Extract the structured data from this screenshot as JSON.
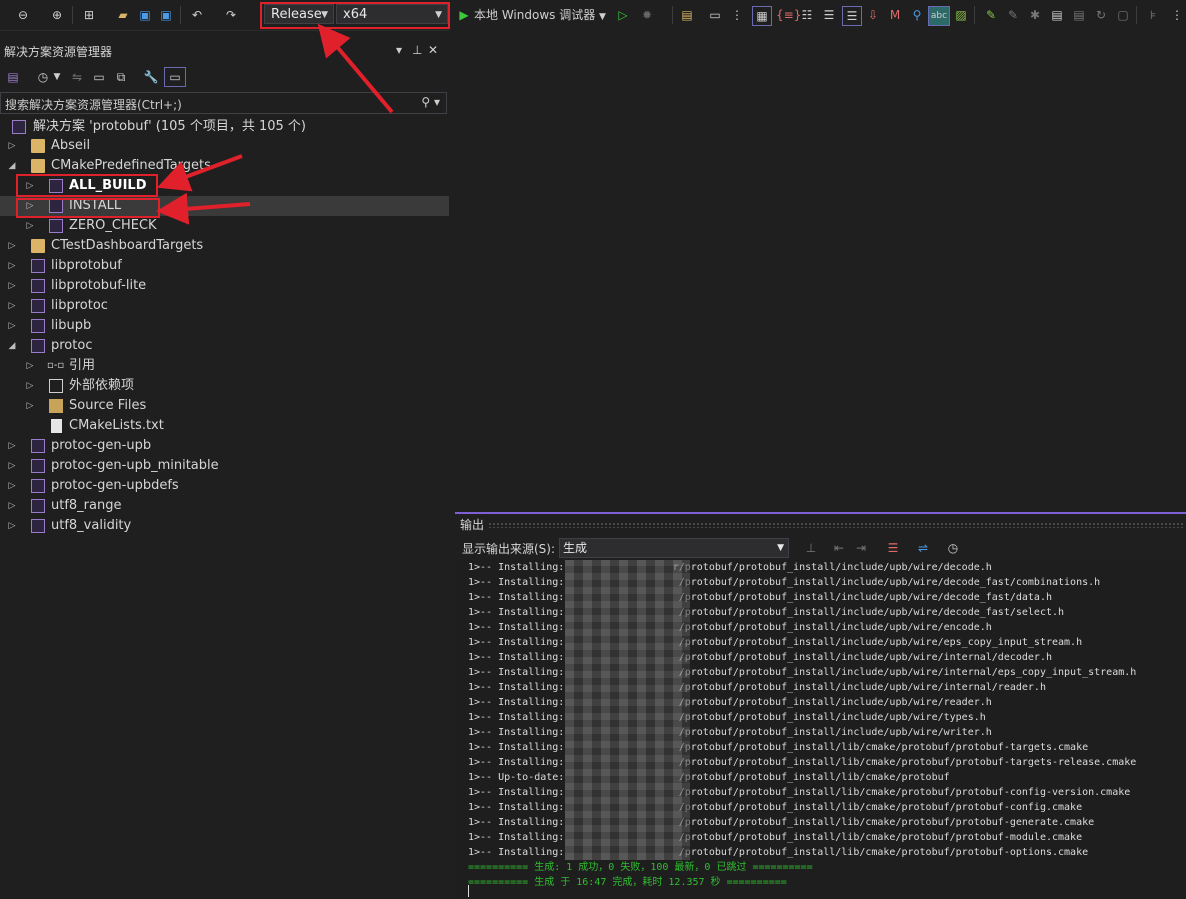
{
  "toolbar": {
    "config": "Release",
    "platform": "x64",
    "run_label": "本地 Windows 调试器"
  },
  "solution_explorer": {
    "title": "解决方案资源管理器",
    "pin": "▾ ⊥ ✕",
    "search_placeholder": "搜索解决方案资源管理器(Ctrl+;)",
    "solution_label": "解决方案 'protobuf' (105 个项目，共 105 个)",
    "items": [
      {
        "label": "Abseil"
      },
      {
        "label": "CMakePredefinedTargets"
      },
      {
        "label": "ALL_BUILD"
      },
      {
        "label": "INSTALL"
      },
      {
        "label": "ZERO_CHECK"
      },
      {
        "label": "CTestDashboardTargets"
      },
      {
        "label": "libprotobuf"
      },
      {
        "label": "libprotobuf-lite"
      },
      {
        "label": "libprotoc"
      },
      {
        "label": "libupb"
      },
      {
        "label": "protoc"
      },
      {
        "label": "引用"
      },
      {
        "label": "外部依赖项"
      },
      {
        "label": "Source Files"
      },
      {
        "label": "CMakeLists.txt"
      },
      {
        "label": "protoc-gen-upb"
      },
      {
        "label": "protoc-gen-upb_minitable"
      },
      {
        "label": "protoc-gen-upbdefs"
      },
      {
        "label": "utf8_range"
      },
      {
        "label": "utf8_validity"
      }
    ]
  },
  "output": {
    "title": "输出",
    "source_label": "显示输出来源(S):",
    "source_value": "生成",
    "lines": [
      "1>-- Installing:                  r/protobuf/protobuf_install/include/upb/wire/decode.h",
      "1>-- Installing:                   /protobuf/protobuf_install/include/upb/wire/decode_fast/combinations.h",
      "1>-- Installing:                   /protobuf/protobuf_install/include/upb/wire/decode_fast/data.h",
      "1>-- Installing:                   /protobuf/protobuf_install/include/upb/wire/decode_fast/select.h",
      "1>-- Installing:                   /protobuf/protobuf_install/include/upb/wire/encode.h",
      "1>-- Installing:                   /protobuf/protobuf_install/include/upb/wire/eps_copy_input_stream.h",
      "1>-- Installing:                   /protobuf/protobuf_install/include/upb/wire/internal/decoder.h",
      "1>-- Installing:                   /protobuf/protobuf_install/include/upb/wire/internal/eps_copy_input_stream.h",
      "1>-- Installing:                   /protobuf/protobuf_install/include/upb/wire/internal/reader.h",
      "1>-- Installing:                   /protobuf/protobuf_install/include/upb/wire/reader.h",
      "1>-- Installing:                   /protobuf/protobuf_install/include/upb/wire/types.h",
      "1>-- Installing:                   /protobuf/protobuf_install/include/upb/wire/writer.h",
      "1>-- Installing:                   /protobuf/protobuf_install/lib/cmake/protobuf/protobuf-targets.cmake",
      "1>-- Installing:                   /protobuf/protobuf_install/lib/cmake/protobuf/protobuf-targets-release.cmake",
      "1>-- Up-to-date:                   /protobuf/protobuf_install/lib/cmake/protobuf",
      "1>-- Installing:                   /protobuf/protobuf_install/lib/cmake/protobuf/protobuf-config-version.cmake",
      "1>-- Installing:                   /protobuf/protobuf_install/lib/cmake/protobuf/protobuf-config.cmake",
      "1>-- Installing:                   /protobuf/protobuf_install/lib/cmake/protobuf/protobuf-generate.cmake",
      "1>-- Installing:                   /protobuf/protobuf_install/lib/cmake/protobuf/protobuf-module.cmake",
      "1>-- Installing:                   /protobuf/protobuf_install/lib/cmake/protobuf/protobuf-options.cmake"
    ],
    "summary1": "========== 生成: 1 成功，0 失败，100 最新，0 已跳过 ==========",
    "summary2": "========== 生成 于 16:47 完成，耗时 12.357 秒 =========="
  },
  "colors": {
    "annotation": "#e0202a",
    "accent": "#7f5fd6",
    "run_green": "#3cc73c",
    "log_green": "#2fbf2f"
  }
}
